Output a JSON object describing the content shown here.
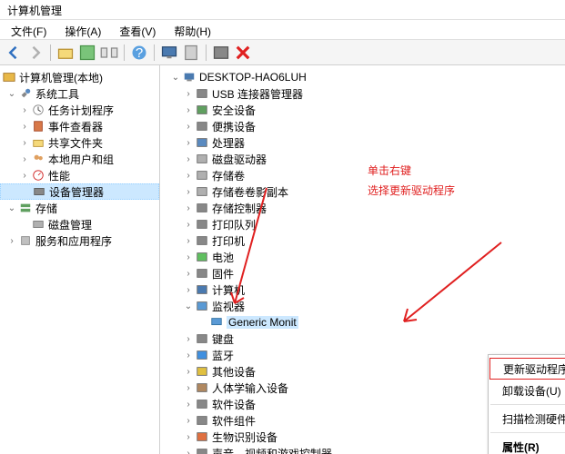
{
  "window": {
    "title": "计算机管理"
  },
  "menu": {
    "file": "文件(F)",
    "action": "操作(A)",
    "view": "查看(V)",
    "help": "帮助(H)"
  },
  "left_tree": {
    "root": "计算机管理(本地)",
    "sys_tools": "系统工具",
    "task": "任务计划程序",
    "event": "事件查看器",
    "share": "共享文件夹",
    "users": "本地用户和组",
    "perf": "性能",
    "devmgr": "设备管理器",
    "storage": "存储",
    "disk": "磁盘管理",
    "services": "服务和应用程序"
  },
  "right_tree": {
    "computer": "DESKTOP-HAO6LUH",
    "items": [
      "USB 连接器管理器",
      "安全设备",
      "便携设备",
      "处理器",
      "磁盘驱动器",
      "存储卷",
      "存储卷卷影副本",
      "存储控制器",
      "打印队列",
      "打印机",
      "电池",
      "固件",
      "计算机",
      "监视器"
    ],
    "monitor_child": "Generic Monit",
    "items2": [
      "键盘",
      "蓝牙",
      "其他设备",
      "人体学输入设备",
      "软件设备",
      "软件组件",
      "生物识别设备",
      "声音、视频和游戏控制器"
    ]
  },
  "context": {
    "update": "更新驱动程序(P)",
    "uninstall": "卸载设备(U)",
    "scan": "扫描检测硬件改动(A)",
    "props": "属性(R)"
  },
  "annotation": {
    "line1": "单击右键",
    "line2": "选择更新驱动程序"
  }
}
